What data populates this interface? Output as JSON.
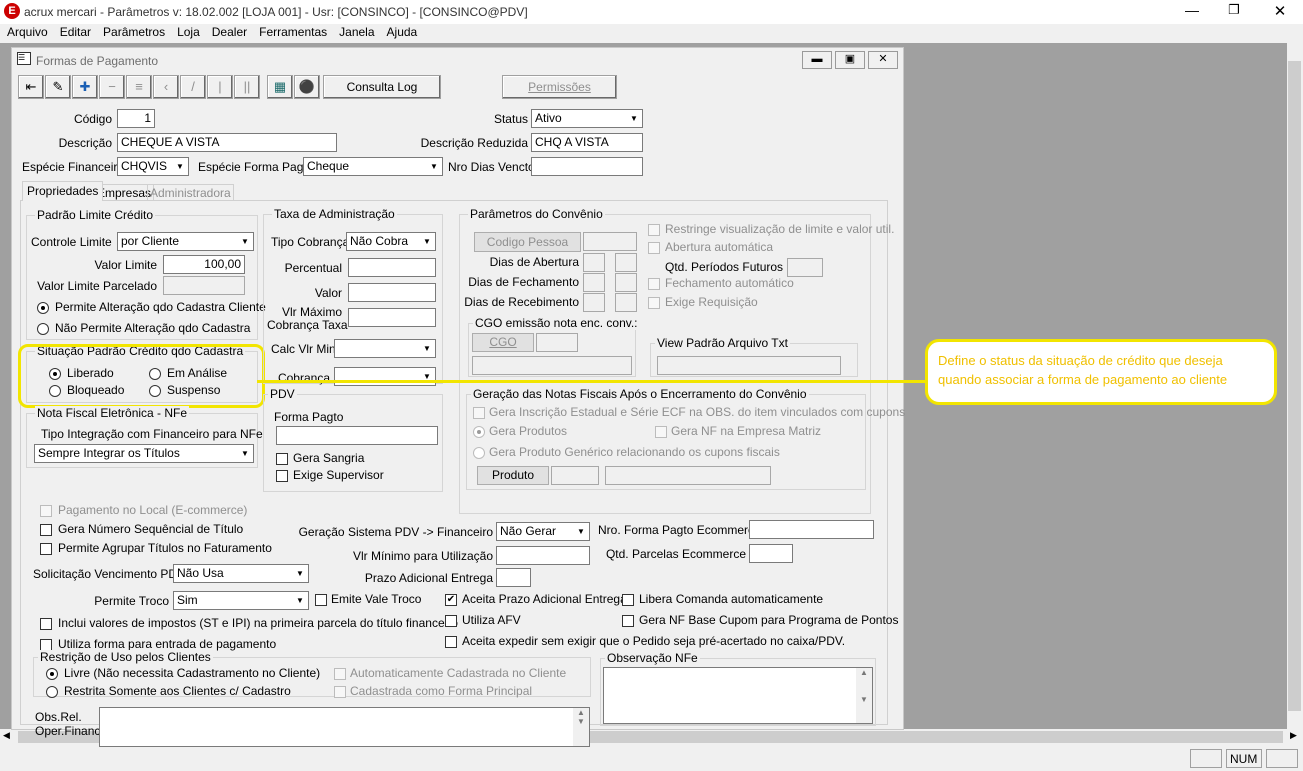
{
  "app": {
    "title": "acrux mercari - Parâmetros  v: 18.02.002   [LOJA 001] - Usr: [CONSINCO] - [CONSINCO@PDV]"
  },
  "menu": [
    "Arquivo",
    "Editar",
    "Parâmetros",
    "Loja",
    "Dealer",
    "Ferramentas",
    "Janela",
    "Ajuda"
  ],
  "window": {
    "title": "Formas de Pagamento"
  },
  "toolbar": {
    "consulta_log": "Consulta Log",
    "permissoes": "Permissões"
  },
  "fields": {
    "codigo_label": "Código",
    "codigo": "1",
    "status_label": "Status",
    "status": "Ativo",
    "descricao_label": "Descrição",
    "descricao": "CHEQUE A VISTA",
    "descr_reduzida_label": "Descrição Reduzida",
    "descr_reduzida": "CHQ A VISTA",
    "especie_fin_label": "Espécie Financeira",
    "especie_fin": "CHQVIS",
    "especie_forma_label": "Espécie Forma Pagto",
    "especie_forma": "Cheque",
    "nro_dias_label": "Nro Dias Vencto"
  },
  "tabs": [
    "Propriedades",
    "Empresas",
    "Administradora"
  ],
  "limite": {
    "title": "Padrão Limite Crédito",
    "controle_label": "Controle Limite",
    "controle": "por Cliente",
    "valor_label": "Valor Limite",
    "valor": "100,00",
    "parcelado_label": "Valor Limite Parcelado",
    "opt1": "Permite Alteração qdo Cadastra Cliente",
    "opt2": "Não Permite Alteração qdo Cadastra"
  },
  "situacao": {
    "title": "Situação Padrão Crédito qdo Cadastra",
    "liberado": "Liberado",
    "analise": "Em Análise",
    "bloqueado": "Bloqueado",
    "suspenso": "Suspenso"
  },
  "nfe": {
    "title": "Nota Fiscal Eletrônica - NFe",
    "tipo_label": "Tipo Integração com Financeiro para NFe",
    "tipo": "Sempre Integrar os Títulos"
  },
  "taxa": {
    "title": "Taxa de Administração",
    "tipo_label": "Tipo Cobrança",
    "tipo": "Não Cobra",
    "percentual": "Percentual",
    "valor": "Valor",
    "vlr_max": "Vlr Máximo",
    "cobr_taxa": "Cobrança Taxa",
    "calc": "Calc Vlr Min",
    "cobranca": "Cobrança"
  },
  "pdv": {
    "title": "PDV",
    "forma": "Forma Pagto",
    "sangria": "Gera Sangria",
    "supervisor": "Exige Supervisor"
  },
  "convenio": {
    "title": "Parâmetros do Convênio",
    "codigo_pessoa": "Codigo Pessoa",
    "dias_abertura": "Dias de Abertura",
    "dias_fechamento": "Dias de Fechamento",
    "dias_recebimento": "Dias de Recebimento",
    "restringe": "Restringe visualização de limite e valor util.",
    "abertura": "Abertura automática",
    "qtd_periodos": "Qtd. Períodos Futuros",
    "fechamento": "Fechamento automático",
    "exige_req": "Exige Requisição",
    "cgo_title": "CGO emissão nota enc. conv.:",
    "cgo": "CGO",
    "view_title": "View Padrão Arquivo Txt"
  },
  "geracao": {
    "title": "Geração das Notas Fiscais Após o Encerramento do Convênio",
    "opt1": "Gera Inscrição Estadual e Série ECF na OBS. do item vinculados com cupons",
    "opt2": "Gera Produtos",
    "opt3": "Gera NF na Empresa Matriz",
    "opt4": "Gera Produto Genérico relacionando os cupons fiscais",
    "produto": "Produto"
  },
  "checks": {
    "pag_local": "Pagamento no Local (E-commerce)",
    "gera_num": "Gera Número Sequêncial de Título",
    "agrupar": "Permite Agrupar Títulos no Faturamento",
    "solic_label": "Solicitação Vencimento PDV",
    "solic": "Não Usa",
    "troco_label": "Permite Troco",
    "troco": "Sim",
    "vale_troco": "Emite Vale Troco",
    "impostos": "Inclui valores de impostos (ST e IPI) na primeira parcela do título financeiro",
    "entrada": "Utiliza forma para entrada de pagamento",
    "ger_pdv_label": "Geração Sistema PDV -> Financeiro",
    "ger_pdv": "Não Gerar",
    "vlr_min": "Vlr Mínimo para Utilização",
    "prazo_adic": "Prazo Adicional Entrega",
    "nro_forma_ecom": "Nro. Forma Pagto Ecommerce",
    "qtd_parc_ecom": "Qtd. Parcelas Ecommerce",
    "aceita_prazo": "Aceita Prazo Adicional Entrega",
    "libera_comanda": "Libera Comanda automaticamente",
    "utiliza_afv": "Utiliza AFV",
    "gera_nf_cupom": "Gera NF Base Cupom para Programa de Pontos",
    "aceita_expedir": "Aceita expedir sem exigir que o Pedido seja pré-acertado no caixa/PDV."
  },
  "restricao": {
    "title": "Restrição de Uso pelos Clientes",
    "livre": "Livre (Não necessita Cadastramento no Cliente)",
    "restrita": "Restrita Somente aos Clientes c/ Cadastro",
    "auto": "Automaticamente Cadastrada no Cliente",
    "principal": "Cadastrada como Forma Principal"
  },
  "obs_nfe": {
    "title": "Observação NFe"
  },
  "obs_rel": {
    "label1": "Obs.Rel.",
    "label2": "Oper.Financ."
  },
  "callout": "Define o status da situação de crédito que deseja quando associar a forma de pagamento ao cliente",
  "statusbar": {
    "num": "NUM"
  },
  "colors": {
    "callout_border": "#f2e500",
    "callout_text": "#f0c000",
    "logo": "#cc0000"
  }
}
